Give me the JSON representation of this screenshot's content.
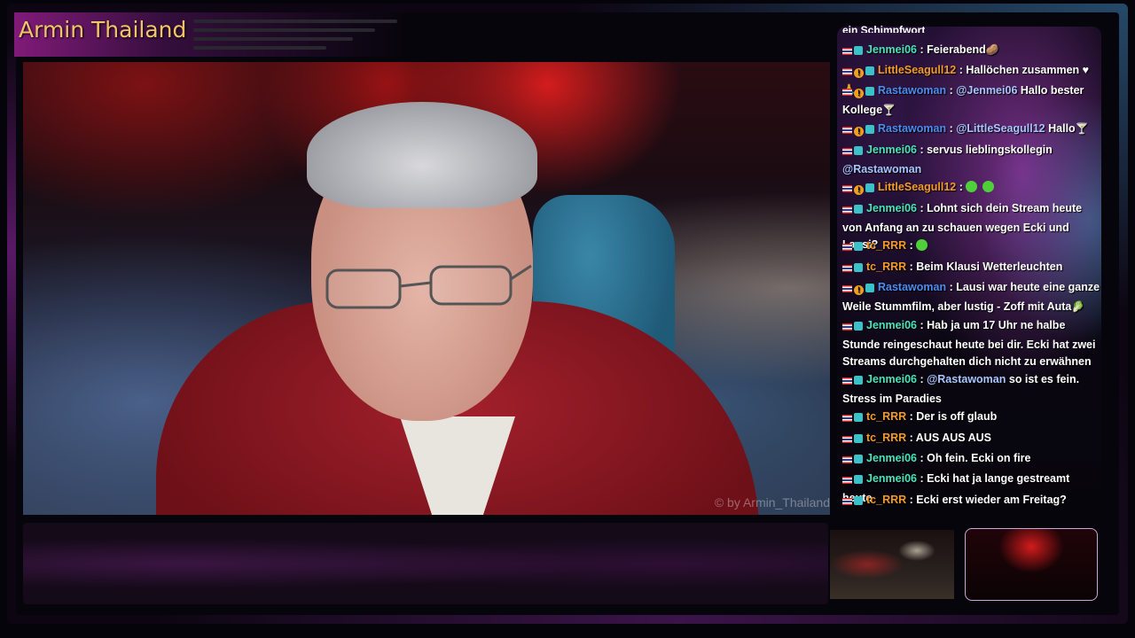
{
  "overlay": {
    "streamer_name": "Armin Thailand",
    "watermark": "© by Armin_Thailand"
  },
  "chat": {
    "truncated_top": "ein Schimpfwort",
    "messages": [
      {
        "user": "Jenmei06",
        "user_class": "jen",
        "badge_o": false,
        "text": ": Feierabend",
        "emote": "🥔"
      },
      {
        "user": "LittleSeagull12",
        "user_class": "little",
        "badge_o": true,
        "text": ": Hallöchen zusammen ♥",
        "emote": "🙏"
      },
      {
        "user": "Rastawoman",
        "user_class": "rasta",
        "badge_o": true,
        "mention": "@Jenmei06",
        "text": " Hallo bester Kollege",
        "emote": "🍸"
      },
      {
        "user": "Rastawoman",
        "user_class": "rasta",
        "badge_o": true,
        "mention": "@LittleSeagull12",
        "text": " Hallo",
        "emote": "🍸"
      },
      {
        "user": "Jenmei06",
        "user_class": "jen",
        "badge_o": false,
        "text": ": servus lieblingskollegin ",
        "mention_after": "@Rastawoman"
      },
      {
        "user": "LittleSeagull12",
        "user_class": "little",
        "badge_o": true,
        "text": ":",
        "green_emotes": 2
      },
      {
        "user": "Jenmei06",
        "user_class": "jen",
        "badge_o": false,
        "text": ": Lohnt sich dein Stream heute von Anfang an zu schauen wegen Ecki und Lausi?"
      },
      {
        "user": "tc_RRR",
        "user_class": "tc",
        "badge_o": false,
        "text": ":",
        "green_emotes": 1
      },
      {
        "user": "tc_RRR",
        "user_class": "tc",
        "badge_o": false,
        "text": ": Beim Klausi Wetterleuchten"
      },
      {
        "user": "Rastawoman",
        "user_class": "rasta",
        "badge_o": true,
        "text": ": Lausi war heute eine ganze Weile Stummfilm, aber lustig - Zoff mit Auta",
        "emote": "🥬"
      },
      {
        "user": "Jenmei06",
        "user_class": "jen",
        "badge_o": false,
        "text": ": Hab ja um 17 Uhr ne halbe Stunde reingeschaut heute bei dir. Ecki hat zwei Streams durchgehalten dich nicht zu erwähnen"
      },
      {
        "user": "Jenmei06",
        "user_class": "jen",
        "badge_o": false,
        "mention": "@Rastawoman",
        "text": " so ist es fein. Stress im Paradies"
      },
      {
        "user": "tc_RRR",
        "user_class": "tc",
        "badge_o": false,
        "text": ": Der is off glaub"
      },
      {
        "user": "tc_RRR",
        "user_class": "tc",
        "badge_o": false,
        "text": ": AUS AUS AUS"
      },
      {
        "user": "Jenmei06",
        "user_class": "jen",
        "badge_o": false,
        "text": ": Oh fein. Ecki on fire"
      },
      {
        "user": "Jenmei06",
        "user_class": "jen",
        "badge_o": false,
        "text": ": Ecki hat ja lange gestreamt heute"
      },
      {
        "user": "tc_RRR",
        "user_class": "tc",
        "badge_o": false,
        "text": ": Ecki erst wieder am Freitag?"
      }
    ]
  }
}
